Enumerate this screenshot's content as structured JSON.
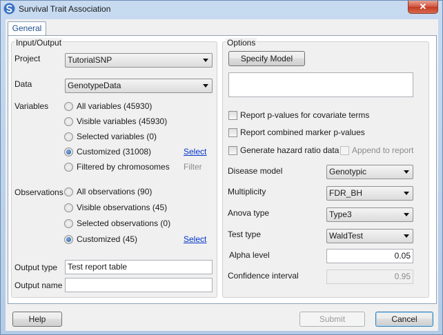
{
  "window": {
    "title": "Survival Trait Association",
    "close_glyph": "✕"
  },
  "tabs": [
    {
      "label": "General"
    }
  ],
  "input_output": {
    "title": "Input/Output",
    "project_label": "Project",
    "project_value": "TutorialSNP",
    "data_label": "Data",
    "data_value": "GenotypeData",
    "variables_label": "Variables",
    "variables": [
      {
        "label": "All variables (45930)",
        "selected": false
      },
      {
        "label": "Visible variables (45930)",
        "selected": false
      },
      {
        "label": "Selected variables (0)",
        "selected": false
      },
      {
        "label": "Customized (31008)",
        "selected": true
      },
      {
        "label": "Filtered by chromosomes",
        "selected": false
      }
    ],
    "variables_select_link": "Select",
    "filter_link": "Filter",
    "observations_label": "Observations",
    "observations": [
      {
        "label": "All observations (90)",
        "selected": false
      },
      {
        "label": "Visible observations (45)",
        "selected": false
      },
      {
        "label": "Selected observations (0)",
        "selected": false
      },
      {
        "label": "Customized (45)",
        "selected": true
      }
    ],
    "observations_select_link": "Select",
    "output_type_label": "Output type",
    "output_type_value": "Test report table",
    "output_name_label": "Output name",
    "output_name_value": ""
  },
  "options": {
    "title": "Options",
    "specify_model_label": "Specify Model",
    "model_text": "",
    "checkboxes": {
      "covariate_pvalues": "Report p-values for covariate terms",
      "combined_marker": "Report combined marker p-values",
      "hazard_ratio": "Generate hazard ratio data",
      "append_report": "Append to report"
    },
    "disease_model_label": "Disease model",
    "disease_model_value": "Genotypic",
    "multiplicity_label": "Multiplicity",
    "multiplicity_value": "FDR_BH",
    "anova_type_label": "Anova type",
    "anova_type_value": "Type3",
    "test_type_label": "Test type",
    "test_type_value": "WaldTest",
    "alpha_level_label": "Alpha level",
    "alpha_level_value": "0.05",
    "confidence_interval_label": "Confidence interval",
    "confidence_interval_value": "0.95"
  },
  "footer": {
    "help_label": "Help",
    "submit_label": "Submit",
    "cancel_label": "Cancel"
  },
  "colors": {
    "link": "#0033cc",
    "close_button": "#c23b22",
    "tab_text": "#1d4f91"
  },
  "icons": {
    "app": "swirl-icon",
    "close": "close-icon"
  }
}
